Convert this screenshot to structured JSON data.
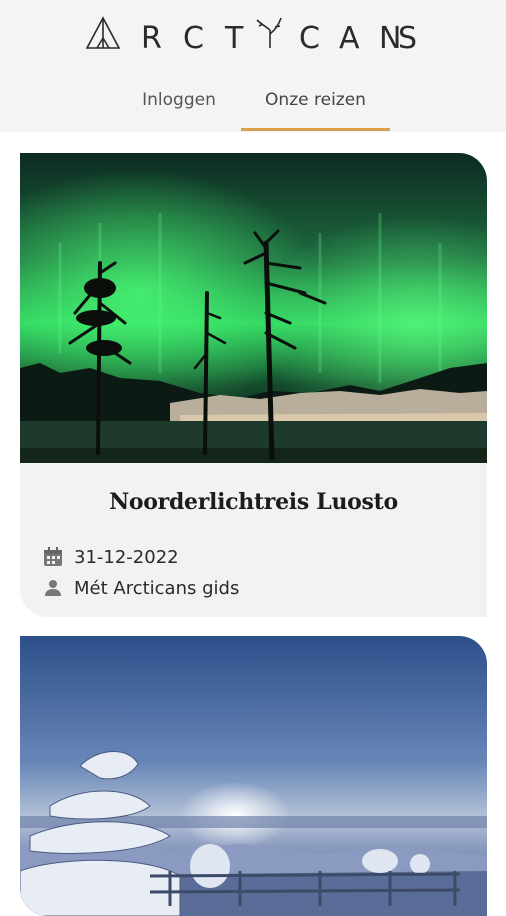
{
  "brand": {
    "logo_text": "ARCTICANS",
    "accent": "#d9a14b"
  },
  "tabs": [
    {
      "label": "Inloggen",
      "active": false
    },
    {
      "label": "Onze reizen",
      "active": true
    }
  ],
  "trips": [
    {
      "title": "Noorderlichtreis Luosto",
      "date": "31-12-2022",
      "guide": "Mét Arcticans gids",
      "date_icon": "calendar-icon",
      "guide_icon": "person-icon"
    },
    {
      "title": "",
      "date": "",
      "guide": ""
    }
  ]
}
